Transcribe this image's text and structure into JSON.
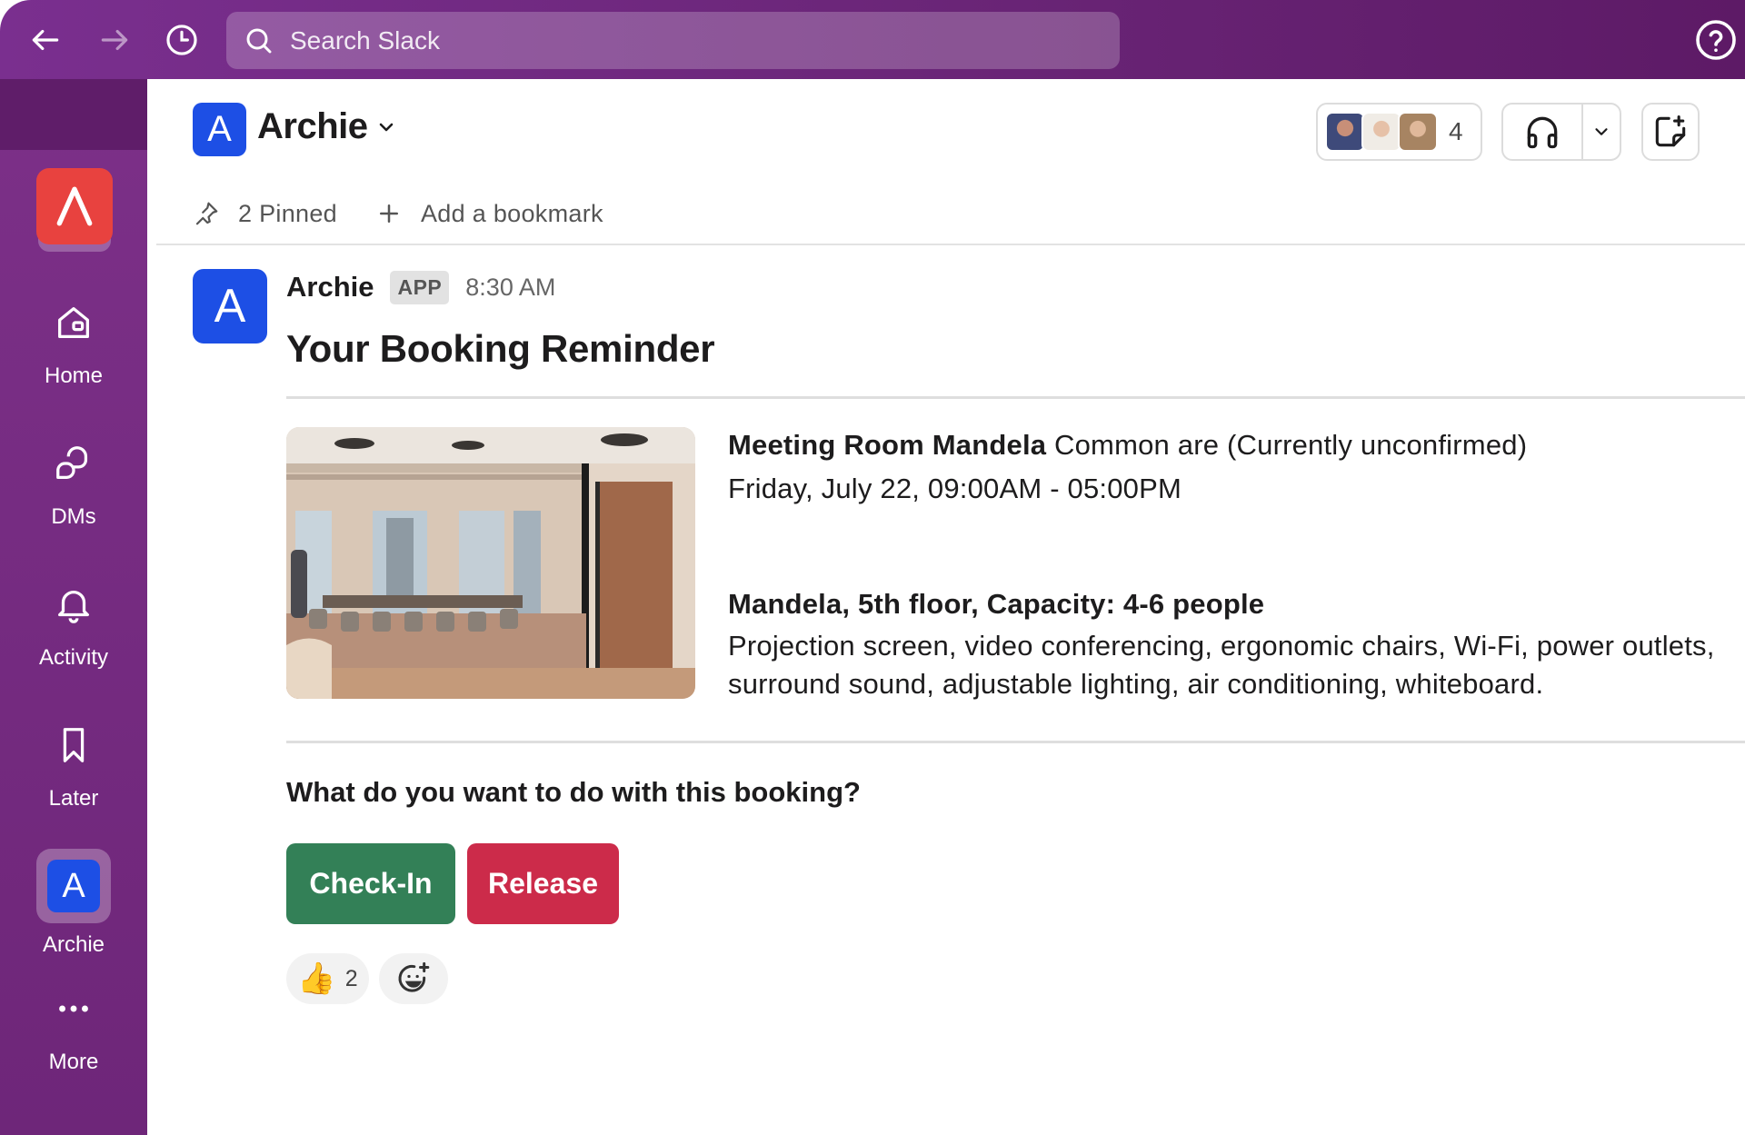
{
  "topbar": {
    "search_placeholder": "Search Slack"
  },
  "sidebar": {
    "items": [
      {
        "label": "Home",
        "icon": "home-icon"
      },
      {
        "label": "DMs",
        "icon": "dms-icon"
      },
      {
        "label": "Activity",
        "icon": "bell-icon"
      },
      {
        "label": "Later",
        "icon": "bookmark-icon"
      },
      {
        "label": "Archie",
        "icon": "archie-app-icon",
        "letter": "A"
      },
      {
        "label": "More",
        "icon": "more-icon"
      }
    ]
  },
  "channel": {
    "avatar_letter": "A",
    "name": "Archie",
    "member_count": "4",
    "bookmarks": {
      "pinned": "2 Pinned",
      "add": "Add a bookmark"
    }
  },
  "message": {
    "avatar_letter": "A",
    "sender": "Archie",
    "badge": "APP",
    "time": "8:30 AM",
    "title": "Your Booking Reminder",
    "room_name": "Meeting Room Mandela",
    "room_status": "Common are (Currently unconfirmed)",
    "datetime": "Friday, July 22, 09:00AM - 05:00PM",
    "room_summary": "Mandela, 5th floor, Capacity: 4-6 people",
    "amenities": "Projection screen, video conferencing, ergonomic chairs, Wi-Fi, power outlets, surround sound, adjustable lighting, air conditioning, whiteboard.",
    "question": "What do you want to do with this booking?",
    "actions": {
      "checkin": "Check-In",
      "release": "Release"
    },
    "reactions": {
      "emoji": "👍",
      "count": "2"
    }
  },
  "colors": {
    "topbar": "#6a2577",
    "sidebar": "#7c3088",
    "app_blue": "#1d4fe5",
    "workspace_red": "#e8423f",
    "checkin_green": "#338057",
    "release_red": "#cc2b4a"
  }
}
